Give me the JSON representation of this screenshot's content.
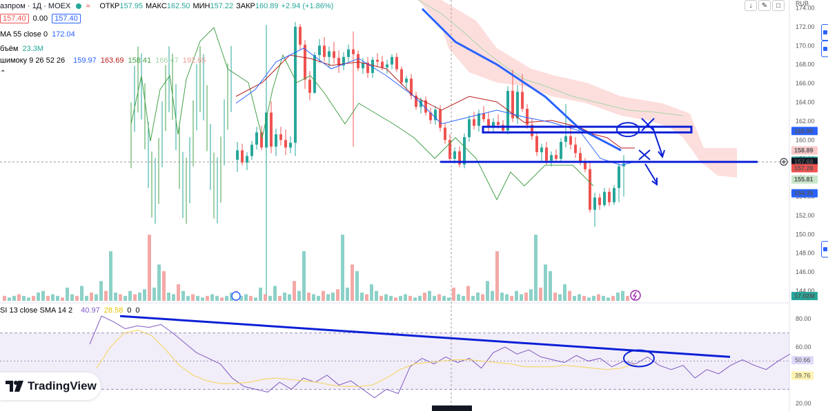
{
  "header": {
    "symbol": "азпром · 1Д · MOEX",
    "open_label": "ОТКР",
    "open": "157.95",
    "high_label": "МАКС",
    "high": "162.50",
    "low_label": "МИН",
    "low": "157.22",
    "close_label": "ЗАКР",
    "close": "160.89",
    "change": "+2.94 (+1.86%)",
    "currency": "RUB"
  },
  "price_boxes": {
    "bid": "157.40",
    "spread": "0.00",
    "ask": "157.40"
  },
  "indicators": {
    "ma": {
      "label": "MA 55 close 0",
      "value": "172.04"
    },
    "volume": {
      "label": "бъём",
      "value": "23.3M"
    },
    "ichimoku": {
      "label": "шимоку 9 26 52 26",
      "v1": "159.97",
      "v2": "163.69",
      "v3": "158.41",
      "v4": "166.47",
      "v5": "192.65"
    },
    "rsi": {
      "label": "SI 13 close SMA 14 2",
      "v1": "40.97",
      "v2": "28.58",
      "v3": "0",
      "v4": "0"
    }
  },
  "toolbar": {
    "arrow_down": "↓",
    "settings": "✎",
    "fullscreen": "□"
  },
  "brand": {
    "name": "TradingView"
  },
  "price_axis": {
    "ticks": [
      174,
      172,
      170,
      168,
      166,
      164,
      162,
      160,
      158,
      156,
      154,
      152,
      150,
      148,
      146,
      144
    ],
    "range": [
      143.6,
      174.4
    ]
  },
  "price_labels": [
    {
      "text": "160.95",
      "color": "#2962ff",
      "value": 160.95
    },
    {
      "text": "158.89",
      "color": "#f7c9c9",
      "value": 158.89
    },
    {
      "text": "157.40",
      "color": "#26a69a",
      "value": 157.8
    },
    {
      "text": "157.68",
      "color": "#131722",
      "value": 157.68
    },
    {
      "text": "157.28",
      "color": "#ef5350",
      "value": 157.0
    },
    {
      "text": "155.81",
      "color": "#c8e6c9",
      "value": 155.81
    },
    {
      "text": "154.35",
      "color": "#2962ff",
      "value": 154.35
    }
  ],
  "volume_label": {
    "text": "17.02M",
    "color": "#26a69a"
  },
  "rsi_axis": {
    "ticks": [
      80,
      60,
      40,
      20
    ],
    "range": [
      18,
      84
    ]
  },
  "rsi_labels": [
    {
      "text": "50.66",
      "color": "#e1d9fb",
      "value": 50.66
    },
    {
      "text": "39.76",
      "color": "#fff3b0",
      "value": 39.76
    }
  ],
  "chart_data": {
    "type": "candlestick",
    "title": "",
    "ylim": [
      143.6,
      174.4
    ],
    "candles": [
      [
        157.9,
        159.8,
        156.6,
        158.9
      ],
      [
        158.9,
        159.6,
        157.3,
        157.6
      ],
      [
        157.6,
        158.7,
        156.8,
        158.3
      ],
      [
        158.3,
        159.9,
        157.9,
        159.5
      ],
      [
        159.5,
        161.4,
        159.0,
        160.8
      ],
      [
        160.8,
        161.5,
        158.9,
        159.2
      ],
      [
        159.2,
        172.2,
        143.6,
        162.9
      ],
      [
        162.9,
        164.1,
        158.6,
        159.3
      ],
      [
        159.3,
        161.2,
        158.3,
        160.6
      ],
      [
        160.6,
        161.4,
        159.4,
        160.0
      ],
      [
        160.0,
        161.1,
        158.4,
        159.2
      ],
      [
        159.2,
        160.4,
        158.6,
        159.7
      ],
      [
        159.7,
        172.5,
        158.3,
        172.0
      ],
      [
        172.0,
        172.3,
        169.6,
        170.1
      ],
      [
        170.1,
        170.6,
        165.4,
        166.4
      ],
      [
        166.4,
        167.3,
        164.2,
        165.0
      ],
      [
        165.0,
        169.3,
        164.9,
        169.0
      ],
      [
        169.0,
        170.7,
        168.2,
        170.0
      ],
      [
        170.0,
        170.9,
        168.3,
        168.8
      ],
      [
        168.8,
        169.9,
        167.7,
        169.4
      ],
      [
        169.4,
        170.4,
        168.1,
        168.7
      ],
      [
        168.7,
        169.5,
        167.1,
        167.9
      ],
      [
        167.9,
        169.3,
        167.4,
        168.8
      ],
      [
        168.8,
        170.1,
        168.3,
        169.6
      ],
      [
        169.6,
        171.5,
        159.3,
        169.1
      ],
      [
        169.1,
        169.5,
        167.3,
        167.6
      ],
      [
        167.6,
        168.7,
        167.0,
        168.2
      ],
      [
        168.2,
        168.8,
        166.6,
        167.1
      ],
      [
        167.1,
        168.8,
        166.6,
        168.5
      ],
      [
        168.5,
        169.2,
        167.8,
        168.3
      ],
      [
        168.3,
        168.9,
        167.4,
        167.7
      ],
      [
        167.7,
        168.5,
        167.0,
        168.0
      ],
      [
        168.0,
        169.1,
        167.5,
        168.8
      ],
      [
        168.8,
        169.2,
        167.2,
        167.5
      ],
      [
        167.5,
        167.8,
        165.8,
        166.1
      ],
      [
        166.1,
        166.8,
        165.3,
        166.5
      ],
      [
        166.5,
        167.0,
        164.3,
        164.7
      ],
      [
        164.7,
        165.1,
        163.2,
        163.5
      ],
      [
        163.5,
        164.5,
        162.8,
        164.2
      ],
      [
        164.2,
        164.6,
        162.6,
        162.9
      ],
      [
        162.9,
        163.4,
        161.7,
        162.1
      ],
      [
        162.1,
        163.6,
        161.6,
        163.2
      ],
      [
        163.2,
        163.7,
        160.9,
        161.3
      ],
      [
        161.3,
        161.8,
        159.6,
        160.0
      ],
      [
        160.0,
        160.6,
        157.6,
        158.0
      ],
      [
        158.0,
        159.2,
        157.5,
        158.8
      ],
      [
        158.8,
        159.3,
        157.1,
        157.4
      ],
      [
        157.4,
        160.7,
        157.0,
        160.3
      ],
      [
        160.3,
        162.6,
        159.8,
        162.2
      ],
      [
        162.2,
        163.0,
        161.1,
        161.5
      ],
      [
        161.5,
        163.2,
        160.9,
        162.8
      ],
      [
        162.8,
        163.6,
        161.9,
        162.2
      ],
      [
        162.2,
        162.9,
        160.8,
        161.4
      ],
      [
        161.4,
        162.3,
        160.8,
        161.9
      ],
      [
        161.9,
        162.7,
        161.2,
        161.6
      ],
      [
        161.6,
        162.1,
        160.7,
        161.0
      ],
      [
        161.0,
        165.7,
        160.6,
        165.2
      ],
      [
        165.2,
        167.4,
        161.9,
        162.3
      ],
      [
        162.3,
        165.8,
        161.7,
        165.1
      ],
      [
        165.1,
        167.0,
        163.0,
        163.3
      ],
      [
        163.3,
        163.8,
        161.2,
        161.6
      ],
      [
        161.6,
        162.3,
        160.0,
        160.4
      ],
      [
        160.4,
        160.9,
        158.3,
        158.7
      ],
      [
        158.7,
        159.6,
        157.6,
        159.2
      ],
      [
        159.2,
        159.8,
        157.4,
        157.8
      ],
      [
        157.8,
        158.8,
        157.2,
        158.4
      ],
      [
        158.4,
        159.0,
        157.6,
        158.0
      ],
      [
        158.0,
        160.2,
        157.7,
        159.8
      ],
      [
        159.8,
        163.8,
        159.2,
        160.4
      ],
      [
        160.4,
        161.3,
        159.0,
        159.5
      ],
      [
        159.5,
        160.3,
        158.1,
        158.6
      ],
      [
        158.6,
        159.2,
        157.3,
        157.7
      ],
      [
        157.7,
        158.1,
        156.6,
        156.9
      ],
      [
        156.9,
        157.8,
        152.3,
        152.6
      ],
      [
        152.6,
        154.4,
        150.8,
        153.9
      ],
      [
        153.9,
        154.3,
        152.6,
        153.1
      ],
      [
        153.1,
        154.9,
        152.9,
        154.5
      ],
      [
        154.5,
        154.9,
        153.0,
        153.4
      ],
      [
        153.4,
        155.2,
        153.1,
        154.9
      ],
      [
        154.9,
        157.5,
        153.4,
        157.2
      ],
      [
        157.2,
        158.4,
        154.0,
        157.5
      ]
    ],
    "volume": [
      3,
      3,
      2,
      3,
      2,
      3,
      2,
      4,
      3,
      2,
      3,
      3,
      3,
      2,
      3,
      4,
      2,
      7,
      3,
      3,
      3,
      3,
      3,
      5,
      3,
      6,
      4,
      3,
      3,
      3,
      3,
      3,
      4,
      3,
      3,
      4,
      3,
      3,
      3,
      6,
      3,
      3,
      3,
      3,
      3,
      3,
      3,
      3,
      3,
      3,
      3,
      3,
      3,
      3,
      3,
      3,
      3,
      3,
      3,
      3,
      3,
      5,
      3,
      3,
      3,
      3,
      3,
      3,
      3,
      3,
      3,
      3,
      3,
      3,
      3,
      3,
      3,
      3,
      3,
      3,
      3,
      3,
      3,
      3,
      3,
      3,
      3,
      3,
      3,
      3,
      3,
      3,
      3,
      3,
      3,
      3,
      3,
      3,
      3,
      3,
      3,
      3,
      3,
      3,
      3,
      3,
      3,
      3,
      3,
      3,
      3,
      3,
      3,
      3,
      3,
      3,
      3,
      3,
      3,
      3
    ],
    "ma55": [
      [
        612,
        0,
        173.9
      ],
      [
        660,
        40,
        170.4
      ],
      [
        720,
        68,
        168.0
      ],
      [
        790,
        115,
        164.6
      ],
      [
        840,
        148,
        161.2
      ],
      [
        900,
        178,
        158.9
      ]
    ],
    "rsi": [
      [
        0,
        62
      ],
      [
        4,
        82
      ],
      [
        8,
        78
      ],
      [
        12,
        73
      ],
      [
        16,
        75
      ],
      [
        20,
        74
      ],
      [
        24,
        76
      ],
      [
        28,
        70
      ],
      [
        32,
        63
      ],
      [
        36,
        56
      ],
      [
        40,
        52
      ],
      [
        44,
        48
      ],
      [
        48,
        38
      ],
      [
        52,
        32
      ],
      [
        56,
        30
      ],
      [
        60,
        28
      ],
      [
        64,
        35
      ],
      [
        68,
        30
      ],
      [
        72,
        38
      ],
      [
        76,
        35
      ],
      [
        80,
        40
      ],
      [
        84,
        33
      ],
      [
        88,
        36
      ],
      [
        92,
        30
      ],
      [
        96,
        24
      ],
      [
        100,
        30
      ],
      [
        104,
        27
      ],
      [
        108,
        46
      ],
      [
        112,
        52
      ],
      [
        116,
        48
      ],
      [
        120,
        53
      ],
      [
        124,
        49
      ],
      [
        128,
        52
      ],
      [
        132,
        45
      ],
      [
        136,
        56
      ],
      [
        140,
        60
      ],
      [
        144,
        55
      ],
      [
        148,
        58
      ],
      [
        152,
        53
      ],
      [
        156,
        51
      ],
      [
        160,
        49
      ],
      [
        164,
        54
      ],
      [
        168,
        50
      ],
      [
        172,
        52
      ],
      [
        176,
        46
      ],
      [
        180,
        50
      ],
      [
        184,
        48
      ],
      [
        188,
        53
      ],
      [
        192,
        47
      ],
      [
        196,
        44
      ],
      [
        200,
        47
      ],
      [
        204,
        38
      ],
      [
        208,
        44
      ],
      [
        212,
        41
      ],
      [
        216,
        47
      ],
      [
        220,
        51
      ],
      [
        224,
        47
      ],
      [
        228,
        44
      ],
      [
        232,
        50
      ],
      [
        236,
        55
      ]
    ],
    "rsi_sma": [
      [
        0,
        45
      ],
      [
        20,
        60
      ],
      [
        40,
        70
      ],
      [
        60,
        72
      ],
      [
        80,
        68
      ],
      [
        100,
        58
      ],
      [
        120,
        47
      ],
      [
        140,
        40
      ],
      [
        160,
        36
      ],
      [
        180,
        34
      ],
      [
        200,
        34
      ],
      [
        220,
        35
      ],
      [
        240,
        37
      ],
      [
        260,
        38
      ],
      [
        280,
        37
      ],
      [
        300,
        36
      ],
      [
        320,
        35
      ],
      [
        340,
        33
      ],
      [
        360,
        32
      ],
      [
        380,
        32
      ],
      [
        400,
        33
      ],
      [
        420,
        38
      ],
      [
        440,
        44
      ],
      [
        460,
        48
      ],
      [
        480,
        49
      ],
      [
        500,
        50
      ],
      [
        520,
        51
      ],
      [
        540,
        51
      ],
      [
        560,
        50
      ],
      [
        580,
        49
      ],
      [
        600,
        48
      ],
      [
        620,
        46
      ],
      [
        640,
        46
      ],
      [
        660,
        46
      ],
      [
        680,
        47
      ],
      [
        700,
        46
      ],
      [
        720,
        45
      ],
      [
        740,
        44
      ],
      [
        760,
        45
      ],
      [
        780,
        48
      ]
    ]
  }
}
